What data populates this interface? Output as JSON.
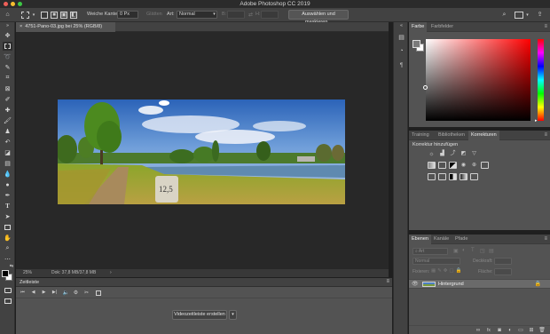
{
  "window": {
    "title": "Adobe Photoshop CC 2019"
  },
  "options_bar": {
    "feather_label": "Weiche Kante:",
    "feather_value": "0 Px",
    "antialias_label": "Glätten",
    "style_label": "Art:",
    "style_value": "Normal",
    "width_label": "B:",
    "height_label": "H:",
    "select_mask_button": "Auswählen und maskieren..."
  },
  "document": {
    "tab_title": "4751-Pano-03.jpg bei 25% (RGB/8)",
    "zoom": "25%",
    "doc_size": "Dok: 37,8 MB/37,8 MB",
    "milestone_text": "12,5"
  },
  "timeline": {
    "panel_title": "Zeitleiste",
    "create_button": "Videozeitleiste erstellen"
  },
  "color_panel": {
    "tabs": [
      "Farbe",
      "Farbfelder"
    ],
    "active_tab": 0,
    "foreground_color": "#7a7a7a",
    "background_color": "#ffffff"
  },
  "adjustments_panel": {
    "tabs": [
      "Training",
      "Bibliotheken",
      "Korrekturen"
    ],
    "active_tab": 2,
    "heading": "Korrektur hinzufügen"
  },
  "layers_panel": {
    "tabs": [
      "Ebenen",
      "Kanäle",
      "Pfade"
    ],
    "active_tab": 0,
    "filter_placeholder": "Art",
    "blend_mode": "Normal",
    "opacity_label": "Deckkraft:",
    "lock_label": "Fixieren:",
    "fill_label": "Fläche:",
    "layers": [
      {
        "name": "Hintergrund"
      }
    ]
  }
}
